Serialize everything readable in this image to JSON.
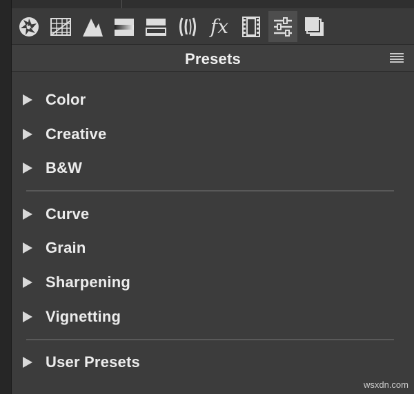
{
  "toolbar": {
    "tools": [
      {
        "name": "aperture-icon"
      },
      {
        "name": "grid-icon"
      },
      {
        "name": "sharpness-icon"
      },
      {
        "name": "gradient-icon"
      },
      {
        "name": "levels-icon"
      },
      {
        "name": "lens-icon"
      },
      {
        "name": "fx-icon",
        "glyph": "fx"
      },
      {
        "name": "film-icon"
      },
      {
        "name": "sliders-icon",
        "active": true
      },
      {
        "name": "layers-icon"
      }
    ]
  },
  "panel": {
    "title": "Presets",
    "menu_icon": "menu-icon"
  },
  "groups": [
    {
      "items": [
        {
          "label": "Color"
        },
        {
          "label": "Creative"
        },
        {
          "label": "B&W"
        }
      ]
    },
    {
      "items": [
        {
          "label": "Curve"
        },
        {
          "label": "Grain"
        },
        {
          "label": "Sharpening"
        },
        {
          "label": "Vignetting"
        }
      ]
    },
    {
      "items": [
        {
          "label": "User Presets"
        }
      ]
    }
  ],
  "watermark": "wsxdn.com",
  "colors": {
    "background": "#3c3c3c",
    "text": "#ececec",
    "active_tool": "#4d4d4d"
  }
}
